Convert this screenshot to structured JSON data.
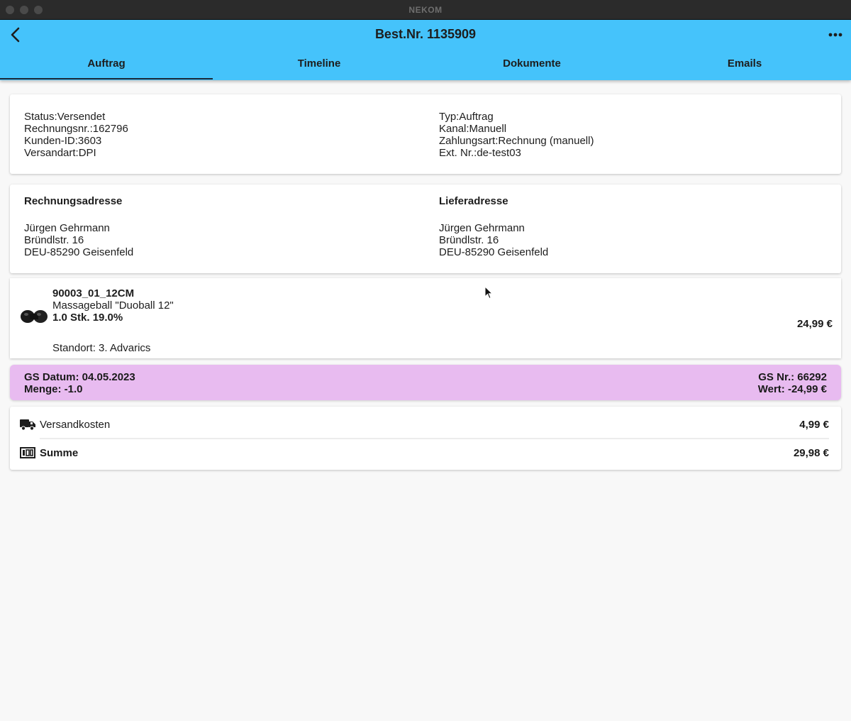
{
  "window": {
    "title": "NEKOM"
  },
  "header": {
    "title": "Best.Nr. 1135909"
  },
  "tabs": [
    {
      "label": "Auftrag",
      "active": true
    },
    {
      "label": "Timeline",
      "active": false
    },
    {
      "label": "Dokumente",
      "active": false
    },
    {
      "label": "Emails",
      "active": false
    }
  ],
  "order_info": {
    "left": [
      "Status:Versendet",
      "Rechnungsnr.:162796",
      "Kunden-ID:3603",
      "Versandart:DPI"
    ],
    "right": [
      "Typ:Auftrag",
      "Kanal:Manuell",
      "Zahlungsart:Rechnung (manuell)",
      "Ext. Nr.:de-test03"
    ]
  },
  "billing_address": {
    "heading": "Rechnungsadresse",
    "lines": [
      "Jürgen Gehrmann",
      "Bründlstr. 16",
      "DEU-85290 Geisenfeld"
    ]
  },
  "shipping_address": {
    "heading": "Lieferadresse",
    "lines": [
      "Jürgen Gehrmann",
      "Bründlstr. 16",
      "DEU-85290 Geisenfeld"
    ]
  },
  "item": {
    "sku": "90003_01_12CM",
    "name": "Massageball \"Duoball 12\"",
    "qty_tax": "1.0 Stk. 19.0%",
    "location": "Standort: 3. Advarics",
    "price": "24,99 €"
  },
  "credit_note": {
    "date": "GS Datum: 04.05.2023",
    "quantity": "Menge: -1.0",
    "number": "GS Nr.: 66292",
    "value": "Wert: -24,99 €",
    "color": "#e8bbf0"
  },
  "totals": {
    "shipping_label": "Versandkosten",
    "shipping_value": "4,99 €",
    "shipping_icon": "truck-icon",
    "sum_label": "Summe",
    "sum_value": "29,98 €",
    "sum_icon": "money-icon"
  },
  "colors": {
    "accent": "#45c3fb"
  }
}
